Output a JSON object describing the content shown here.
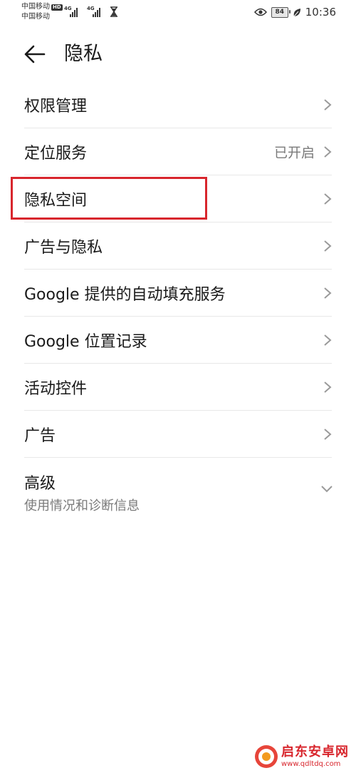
{
  "status_bar": {
    "carrier1": "中国移动",
    "carrier2": "中国移动",
    "hd_label": "HD",
    "network1": "4G",
    "network2": "4G",
    "battery": "84",
    "time": "10:36"
  },
  "header": {
    "title": "隐私"
  },
  "items": [
    {
      "label": "权限管理"
    },
    {
      "label": "定位服务",
      "value": "已开启"
    },
    {
      "label": "隐私空间"
    },
    {
      "label": "广告与隐私"
    },
    {
      "label": "Google 提供的自动填充服务"
    },
    {
      "label": "Google 位置记录"
    },
    {
      "label": "活动控件"
    },
    {
      "label": "广告"
    }
  ],
  "advanced": {
    "label": "高级",
    "subtitle": "使用情况和诊断信息"
  },
  "watermark": {
    "title": "启东安卓网",
    "url": "www.qdltdq.com"
  },
  "colors": {
    "highlight": "#d8262d",
    "text_primary": "#1a1a1a",
    "text_secondary": "#7a7a7a",
    "divider": "#e8e8e8"
  }
}
